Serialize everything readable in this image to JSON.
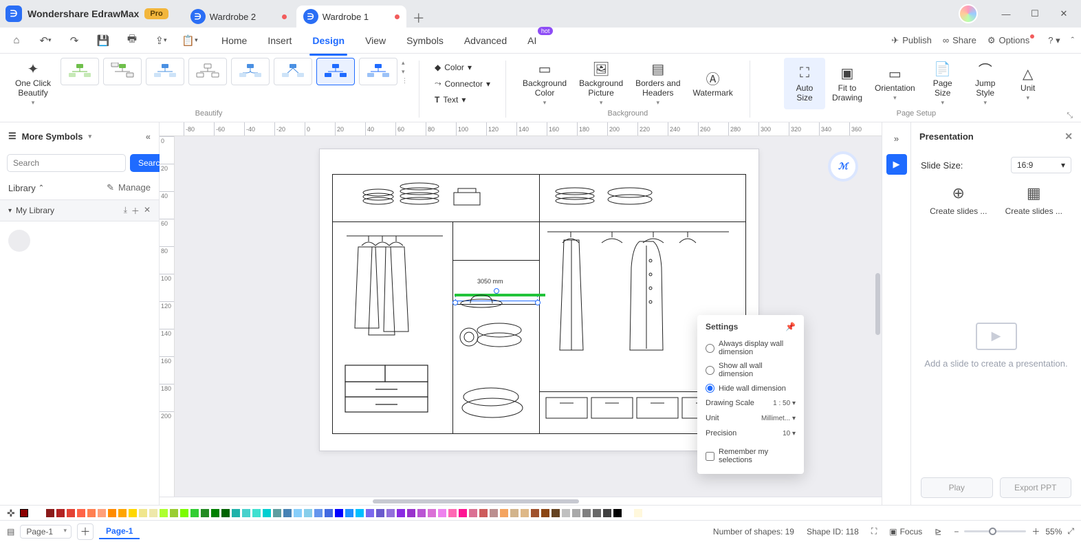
{
  "app": {
    "name": "Wondershare EdrawMax",
    "pro": "Pro"
  },
  "tabs": [
    {
      "label": "Wardrobe 2",
      "modified": true,
      "active": false
    },
    {
      "label": "Wardrobe 1",
      "modified": true,
      "active": true
    }
  ],
  "menubar": {
    "items": [
      "Home",
      "Insert",
      "Design",
      "View",
      "Symbols",
      "Advanced",
      "AI"
    ],
    "active_idx": 2,
    "hot_label": "hot",
    "right": {
      "publish": "Publish",
      "share": "Share",
      "options": "Options"
    }
  },
  "ribbon": {
    "beautify_group": "Beautify",
    "one_click": "One Click\nBeautify",
    "color": "Color",
    "connector": "Connector",
    "text": "Text",
    "background_group": "Background",
    "bg_color": "Background\nColor",
    "bg_pic": "Background\nPicture",
    "borders": "Borders and\nHeaders",
    "watermark": "Watermark",
    "page_group": "Page Setup",
    "autosize": "Auto\nSize",
    "fit": "Fit to\nDrawing",
    "orient": "Orientation",
    "pagesize": "Page\nSize",
    "jump": "Jump\nStyle",
    "unit": "Unit"
  },
  "left_panel": {
    "title": "More Symbols",
    "search_ph": "Search",
    "search_btn": "Search",
    "library": "Library",
    "manage": "Manage",
    "section": "My Library"
  },
  "canvas": {
    "dim_label": "3050 mm",
    "ruler_h": [
      "-80",
      "-60",
      "-40",
      "-20",
      "0",
      "20",
      "40",
      "60",
      "80",
      "100",
      "120",
      "140",
      "160",
      "180",
      "200",
      "220",
      "240",
      "260",
      "280",
      "300",
      "320",
      "340",
      "360"
    ],
    "ruler_v": [
      "0",
      "20",
      "40",
      "60",
      "80",
      "100",
      "120",
      "140",
      "160",
      "180",
      "200"
    ]
  },
  "settings": {
    "title": "Settings",
    "opt1": "Always display wall dimension",
    "opt2": "Show all wall dimension",
    "opt3": "Hide wall dimension",
    "scale_l": "Drawing Scale",
    "scale_v": "1 : 50",
    "unit_l": "Unit",
    "unit_v": "Millimet...",
    "prec_l": "Precision",
    "prec_v": "10",
    "remember": "Remember my selections"
  },
  "right_panel": {
    "title": "Presentation",
    "slide_size": "Slide Size:",
    "ratio": "16:9",
    "create1": "Create slides ...",
    "create2": "Create slides ...",
    "empty": "Add a slide to create a presentation.",
    "play": "Play",
    "export": "Export PPT"
  },
  "statusbar": {
    "page_sel": "Page-1",
    "page_tab": "Page-1",
    "shapes": "Number of shapes: 19",
    "shapeid": "Shape ID: 118",
    "focus": "Focus",
    "zoom": "55%"
  },
  "palette": [
    "#8b1a1a",
    "#b22222",
    "#e34234",
    "#ff6347",
    "#ff7f50",
    "#ffa07a",
    "#ff8c00",
    "#ffa500",
    "#ffd700",
    "#f0e68c",
    "#eee8aa",
    "#adff2f",
    "#9acd32",
    "#7cfc00",
    "#32cd32",
    "#228b22",
    "#008000",
    "#006400",
    "#20b2aa",
    "#48d1cc",
    "#40e0d0",
    "#00ced1",
    "#5f9ea0",
    "#4682b4",
    "#87cefa",
    "#87ceeb",
    "#6495ed",
    "#4169e1",
    "#0000ff",
    "#1e90ff",
    "#00bfff",
    "#7b68ee",
    "#6a5acd",
    "#9370db",
    "#8a2be2",
    "#9932cc",
    "#ba55d3",
    "#da70d6",
    "#ee82ee",
    "#ff69b4",
    "#ff1493",
    "#db7093",
    "#cd5c5c",
    "#bc8f8f",
    "#f4a460",
    "#d2b48c",
    "#deb887",
    "#a0522d",
    "#8b4513",
    "#654321",
    "#c0c0c0",
    "#a9a9a9",
    "#808080",
    "#696969",
    "#404040",
    "#000000",
    "#ffffff",
    "#fff8dc"
  ]
}
